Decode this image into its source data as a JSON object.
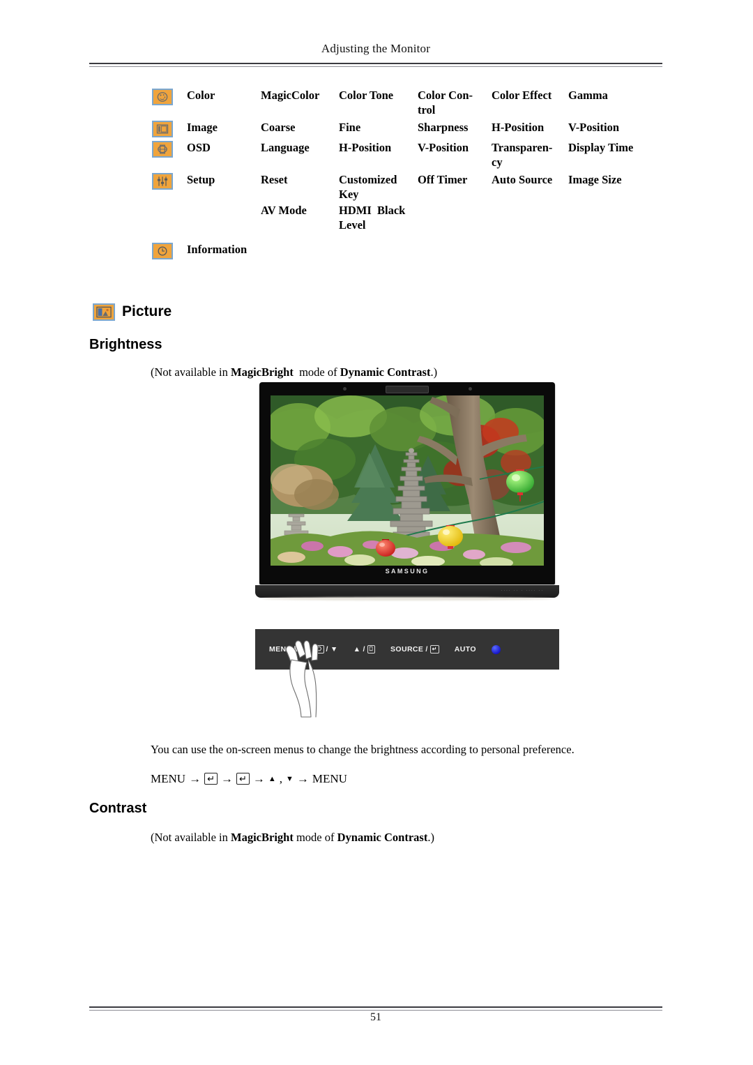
{
  "header": {
    "title": "Adjusting the Monitor"
  },
  "menu_map": {
    "rows": [
      {
        "icon": "color-palette-icon",
        "label": "Color",
        "items": [
          "MagicColor",
          "Color Tone",
          "Color Con-<br>trol",
          "Color Effect",
          "Gamma"
        ]
      },
      {
        "icon": "image-frame-icon",
        "label": "Image",
        "items": [
          "Coarse",
          "Fine",
          "Sharpness",
          "H-Position",
          "V-Position"
        ]
      },
      {
        "icon": "osd-box-icon",
        "label": "OSD",
        "items": [
          "Language",
          "H-Position",
          "V-Position",
          "Transparen-<br>cy",
          "Display Time"
        ]
      },
      {
        "icon": "setup-sliders-icon",
        "label": "Setup",
        "items": [
          "Reset",
          "Customized<br>Key",
          "Off Timer",
          "Auto Source",
          "Image Size"
        ]
      },
      {
        "icon": "",
        "label": "",
        "items": [
          "AV Mode",
          "HDMI&nbsp; Black<br>Level",
          "",
          "",
          ""
        ]
      },
      {
        "icon": "information-clock-icon",
        "label": "Information",
        "items": [
          "",
          "",
          "",
          "",
          ""
        ]
      }
    ]
  },
  "picture_section": {
    "icon": "picture-icon",
    "heading": "Picture"
  },
  "brightness": {
    "heading": "Brightness",
    "note_prefix": "(Not available in ",
    "note_bold1": "MagicBright",
    "note_mid": "&nbsp; mode of ",
    "note_bold2": "Dynamic Contrast",
    "note_suffix": ".)",
    "description": "You can use the on-screen menus to change the brightness according to personal preference.",
    "key_path": {
      "start": "MENU",
      "arrow": "→",
      "enter_key": "↵",
      "up": "▲",
      "comma": ",",
      "down": "▼",
      "end": "MENU"
    }
  },
  "contrast": {
    "heading": "Contrast",
    "note_prefix": "(Not available in ",
    "note_bold1": "MagicBright",
    "note_mid": " mode of ",
    "note_bold2": "Dynamic Contrast",
    "note_suffix": ".)"
  },
  "monitor": {
    "brand_logo": "SAMSUNG",
    "base_tiny_text": "···· ·· · ···· ··",
    "screen_alt": "garden scene with stone pagoda, green trees and paper lanterns"
  },
  "control_panel": {
    "buttons": [
      {
        "name": "menu-button",
        "label": "MENU",
        "key": "Ⅲ"
      },
      {
        "name": "down-button",
        "label": "",
        "key": "⎔",
        "suffix": "▼"
      },
      {
        "name": "up-button",
        "label": "",
        "key": "⎕",
        "prefix": "▲"
      },
      {
        "name": "source-button",
        "label": "SOURCE",
        "key": "↵"
      },
      {
        "name": "auto-button",
        "label": "AUTO",
        "key": ""
      },
      {
        "name": "power-button",
        "label": "",
        "key": ""
      }
    ],
    "menu_label": "MENU",
    "menu_key": "Ⅲ",
    "down_key": "⎔",
    "down_tri": "▼",
    "up_tri": "▲",
    "up_key": "⎕",
    "source_label": "SOURCE",
    "source_key": "↵",
    "auto_label": "AUTO",
    "slash": "/"
  },
  "footer": {
    "page_number": "51"
  },
  "colors": {
    "icon_fill": "#f0a43c",
    "icon_border": "#7ba7cf",
    "rule": "#3a3a40",
    "power_led": "#1616c8"
  }
}
